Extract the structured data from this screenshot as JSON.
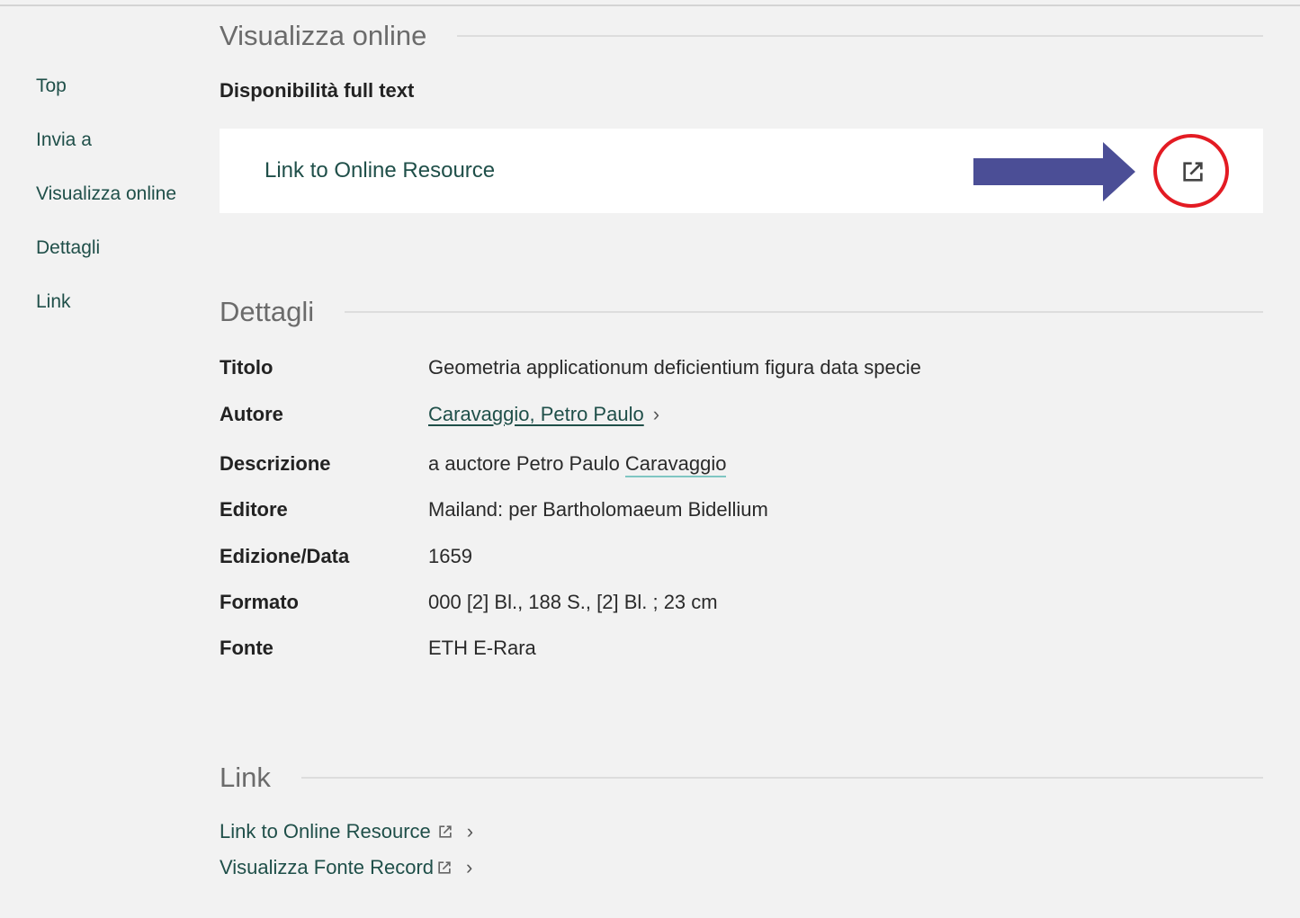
{
  "nav": {
    "items": [
      "Top",
      "Invia a",
      "Visualizza online",
      "Dettagli",
      "Link"
    ]
  },
  "view_online": {
    "heading": "Visualizza online",
    "subheading": "Disponibilità full text",
    "resource_link": "Link to Online Resource",
    "icon": "external-link-icon",
    "arrow_color": "#4b4e96",
    "highlight_color": "#e31b23"
  },
  "details": {
    "heading": "Dettagli",
    "rows": [
      {
        "label": "Titolo",
        "value": "Geometria applicationum deficientium figura data specie"
      },
      {
        "label": "Autore",
        "value": "Caravaggio, Petro Paulo"
      },
      {
        "label": "Descrizione",
        "value_prefix": "a auctore Petro Paulo ",
        "value_highlight": "Caravaggio"
      },
      {
        "label": "Editore",
        "value": "Mailand: per Bartholomaeum Bidellium"
      },
      {
        "label": "Edizione/Data",
        "value": "1659"
      },
      {
        "label": "Formato",
        "value": "000 [2] Bl., 188 S., [2] Bl. ; 23 cm"
      },
      {
        "label": "Fonte",
        "value": "ETH E-Rara"
      }
    ]
  },
  "links": {
    "heading": "Link",
    "items": [
      "Link to Online Resource",
      "Visualizza Fonte Record"
    ]
  },
  "colors": {
    "link_teal": "#1f4f49",
    "background": "#f2f2f2"
  }
}
